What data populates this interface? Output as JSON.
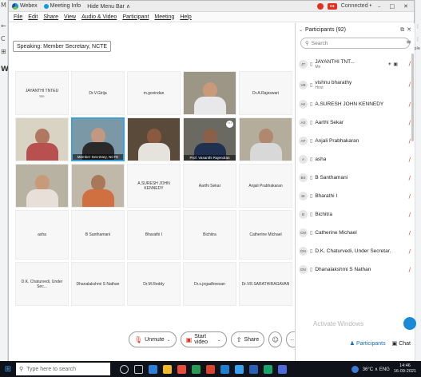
{
  "browser": {
    "left_icons": [
      "M",
      "←",
      "C",
      "⊞"
    ],
    "right_icons": [
      "⋮",
      "⋮",
      "iple"
    ],
    "partial_label": "W"
  },
  "titlebar": {
    "app_name": "Webex",
    "meeting_info": "Meeting Info",
    "hide_menu": "Hide Menu Bar ∧",
    "connection": "Connected •",
    "controls": [
      "–",
      "□",
      "✕"
    ]
  },
  "menu": [
    "File",
    "Edit",
    "Share",
    "View",
    "Audio & Video",
    "Participant",
    "Meeting",
    "Help"
  ],
  "stage": {
    "speaking": "Speaking: Member Secretary, NCTE",
    "rows": [
      [
        {
          "name": "JAYANTHI TNTEU",
          "sub": "Me",
          "video": false
        },
        {
          "name": "Dr.V.Girija",
          "video": false
        },
        {
          "name": "m.govindan",
          "video": false
        },
        {
          "name": "",
          "video": true,
          "skin": "#c89a7a",
          "shirt": "#e8e8ea",
          "bg": "#9c9686"
        },
        {
          "name": "Dr.A.Rajeswari",
          "video": false
        }
      ],
      [
        {
          "name": "",
          "video": true,
          "skin": "#b07860",
          "shirt": "#b85050",
          "bg": "#d9d3c4"
        },
        {
          "name": "Member Secretary, NCTE",
          "video": true,
          "active": true,
          "skin": "#c29880",
          "shirt": "#2a2a2a",
          "bg": "#7a98a6"
        },
        {
          "name": "",
          "video": true,
          "skin": "#8a5a40",
          "shirt": "#e6e2dc",
          "bg": "#5a4a3a"
        },
        {
          "name": "Prof. Vasanthi Rajendran",
          "video": true,
          "more": true,
          "skin": "#8a6048",
          "shirt": "#203050",
          "bg": "#6a6a62"
        },
        {
          "name": "",
          "video": true,
          "skin": "#b08870",
          "shirt": "#d8d8d8",
          "bg": "#b4ad9c"
        }
      ],
      [
        {
          "name": "",
          "video": true,
          "skin": "#c89a7a",
          "shirt": "#e8e0d8",
          "bg": "#b8b2a2"
        },
        {
          "name": "",
          "video": true,
          "skin": "#a87858",
          "shirt": "#d07040",
          "bg": "#c0b8a8"
        },
        {
          "name": "A.SURESH JOHN KENNEDY",
          "video": false
        },
        {
          "name": "Aarthi Sekar",
          "video": false
        },
        {
          "name": "Anjali Prabhakaran",
          "video": false
        }
      ],
      [
        {
          "name": "asha",
          "video": false
        },
        {
          "name": "B Santhamani",
          "video": false
        },
        {
          "name": "Bharathi I",
          "video": false
        },
        {
          "name": "Bichitra",
          "video": false
        },
        {
          "name": "Catherine Michael",
          "video": false
        }
      ],
      [
        {
          "name": "D.K. Chaturvedi, Under Sec...",
          "video": false
        },
        {
          "name": "Dhanalakshmi S Nathan",
          "video": false
        },
        {
          "name": "Dr.M.Reddy",
          "video": false
        },
        {
          "name": "Dr.s.jegadheesan",
          "video": false
        },
        {
          "name": "Dr.VR.SARATHIRAGAVAN",
          "video": false
        }
      ]
    ]
  },
  "controls": {
    "unmute": "Unmute",
    "start_video": "Start video",
    "share": "Share"
  },
  "participants": {
    "title": "Participants (92)",
    "search_placeholder": "Search",
    "list": [
      {
        "initials": "JT",
        "name": "JAYANTHI TNT...",
        "role": "Me"
      },
      {
        "initials": "VB",
        "name": "vishnu bharathy",
        "role": "Host"
      },
      {
        "initials": "AK",
        "name": "A.SURESH JOHN KENNEDY",
        "role": ""
      },
      {
        "initials": "AS",
        "name": "Aarthi Sekar",
        "role": ""
      },
      {
        "initials": "AP",
        "name": "Anjali Prabhakaran",
        "role": ""
      },
      {
        "initials": "A",
        "name": "asha",
        "role": ""
      },
      {
        "initials": "BS",
        "name": "B Santhamani",
        "role": ""
      },
      {
        "initials": "BI",
        "name": "Bharathi I",
        "role": ""
      },
      {
        "initials": "B",
        "name": "Bichitra",
        "role": ""
      },
      {
        "initials": "CM",
        "name": "Catherine Michael",
        "role": ""
      },
      {
        "initials": "DN",
        "name": "D.K. Chaturvedi, Under Secretar...",
        "role": ""
      },
      {
        "initials": "DN",
        "name": "Dhanalakshmi S Nathan",
        "role": ""
      }
    ],
    "activate_text": "Activate Windows",
    "footer_participants": "Participants",
    "footer_chat": "Chat"
  },
  "taskbar": {
    "search_placeholder": "Type here to search",
    "temperature": "36°C ∧ ENG",
    "time": "14:46",
    "date": "16-09-2021"
  },
  "colors": {
    "record": "#e0321e",
    "active_border": "#3da0d8",
    "muted_mic": "#e0321e"
  }
}
